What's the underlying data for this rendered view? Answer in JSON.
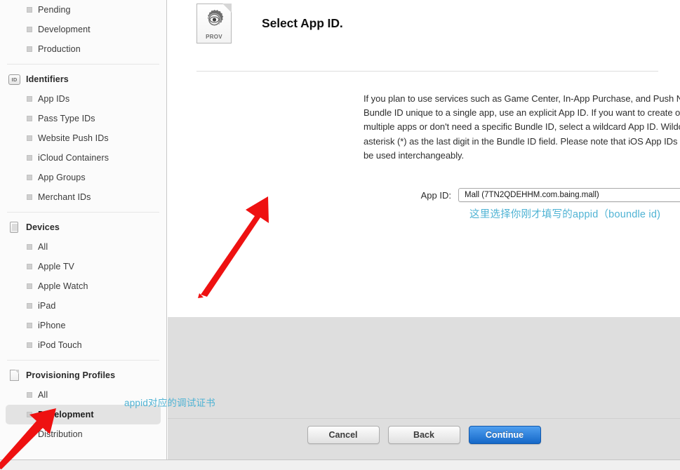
{
  "sidebar": {
    "groups": [
      {
        "header": null,
        "header_icon": null,
        "items": [
          {
            "label": "Pending",
            "icon": "bullet-icon",
            "selected": false
          },
          {
            "label": "Development",
            "icon": "bullet-icon",
            "selected": false
          },
          {
            "label": "Production",
            "icon": "bullet-icon",
            "selected": false
          }
        ]
      },
      {
        "header": "Identifiers",
        "header_icon": "id-badge-icon",
        "header_icon_text": "ID",
        "items": [
          {
            "label": "App IDs",
            "icon": "bullet-icon",
            "selected": false
          },
          {
            "label": "Pass Type IDs",
            "icon": "bullet-icon",
            "selected": false
          },
          {
            "label": "Website Push IDs",
            "icon": "bullet-icon",
            "selected": false
          },
          {
            "label": "iCloud Containers",
            "icon": "bullet-icon",
            "selected": false
          },
          {
            "label": "App Groups",
            "icon": "bullet-icon",
            "selected": false
          },
          {
            "label": "Merchant IDs",
            "icon": "bullet-icon",
            "selected": false
          }
        ]
      },
      {
        "header": "Devices",
        "header_icon": "device-icon",
        "items": [
          {
            "label": "All",
            "icon": "bullet-icon",
            "selected": false
          },
          {
            "label": "Apple TV",
            "icon": "bullet-icon",
            "selected": false
          },
          {
            "label": "Apple Watch",
            "icon": "bullet-icon",
            "selected": false
          },
          {
            "label": "iPad",
            "icon": "bullet-icon",
            "selected": false
          },
          {
            "label": "iPhone",
            "icon": "bullet-icon",
            "selected": false
          },
          {
            "label": "iPod Touch",
            "icon": "bullet-icon",
            "selected": false
          }
        ]
      },
      {
        "header": "Provisioning Profiles",
        "header_icon": "document-icon",
        "items": [
          {
            "label": "All",
            "icon": "bullet-icon",
            "selected": false
          },
          {
            "label": "Development",
            "icon": "bullet-icon",
            "selected": true
          },
          {
            "label": "Distribution",
            "icon": "bullet-icon",
            "selected": false
          }
        ]
      }
    ]
  },
  "main": {
    "icon_label": "PROV",
    "title": "Select App ID.",
    "body": "If you plan to use services such as Game Center, In-App Purchase, and Push Notifications, or want a Bundle ID unique to a single app, use an explicit App ID. If you want to create one provisioning profile for multiple apps or don't need a specific Bundle ID, select a wildcard App ID. Wildcard App IDs use an asterisk (*) as the last digit in the Bundle ID field. Please note that iOS App IDs and Mac App IDs cannot be used interchangeably.",
    "form": {
      "app_id_label": "App ID:",
      "app_id_value": "Mall (7TN2QDEHHM.com.baing.mall)"
    }
  },
  "annotations": {
    "appid_note": "这里选择你刚才填写的appid（boundle id)",
    "cert_note": "appid对应的调试证书",
    "color": "#4fb3d4",
    "arrow_color": "#ee1111"
  },
  "buttons": {
    "cancel": "Cancel",
    "back": "Back",
    "continue": "Continue"
  }
}
